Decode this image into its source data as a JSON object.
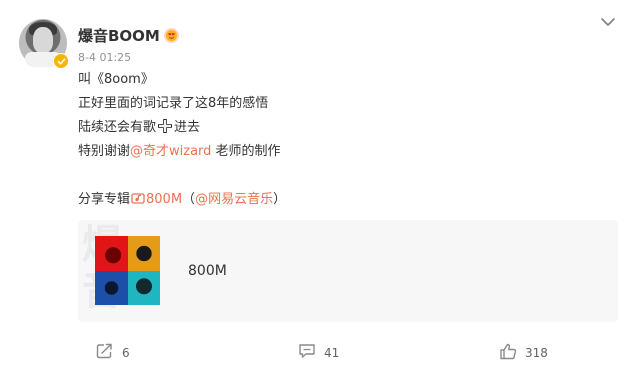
{
  "post": {
    "author": "爆音BOOM",
    "timestamp": "8-4 01:25",
    "lines": {
      "l1": "叫《8oom》",
      "l2": "正好里面的词记录了这8年的感悟",
      "l3a": "陆续还会有歌",
      "l3b": "进去",
      "l4a": "特别谢谢",
      "l4mention": "@奇才wizard",
      "l4b": " 老师的制作",
      "share_prefix": "分享专辑",
      "share_album": "800M",
      "share_paren_open": "（",
      "share_mention": "@网易云音乐",
      "share_paren_close": "）"
    },
    "card": {
      "ghost_text": "爆\n音",
      "title": "800M"
    },
    "actions": {
      "share_count": "6",
      "comment_count": "41",
      "like_count": "318"
    }
  },
  "colors": {
    "accent": "#eb7350",
    "text": "#333333",
    "muted": "#939393",
    "verified": "#f7b500"
  },
  "icons": {
    "verified": "verified-badge-icon",
    "vip": "vip-heart-eyes-icon",
    "more": "chevron-down-icon",
    "plus": "plus-emoji-icon",
    "music": "music-album-icon",
    "share": "share-icon",
    "comment": "comment-icon",
    "like": "thumbs-up-icon"
  }
}
